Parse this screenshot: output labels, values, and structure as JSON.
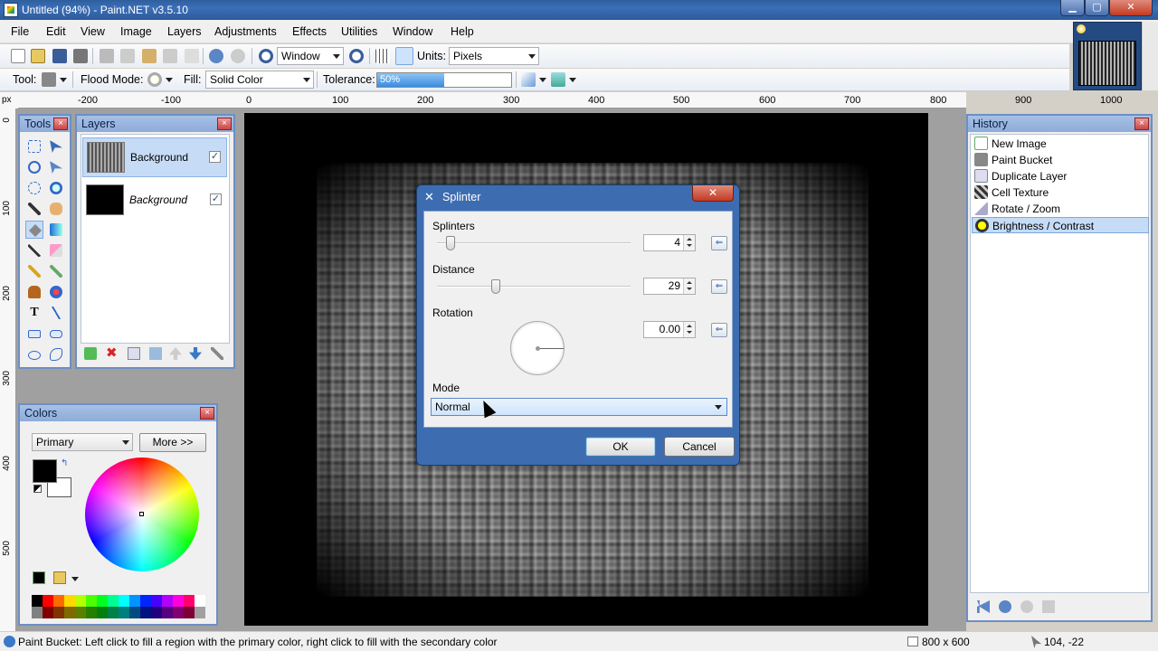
{
  "window": {
    "title": "Untitled (94%) - Paint.NET v3.5.10",
    "minimize_label": "▁",
    "maximize_label": "▢",
    "close_label": "✕"
  },
  "menu": [
    "File",
    "Edit",
    "View",
    "Image",
    "Layers",
    "Adjustments",
    "Effects",
    "Utilities",
    "Window",
    "Help"
  ],
  "toolbar": {
    "zoom_value": "Window",
    "units_label": "Units:",
    "units_value": "Pixels",
    "tool_label": "Tool:",
    "flood_mode_label": "Flood Mode:",
    "fill_label": "Fill:",
    "fill_value": "Solid Color",
    "tolerance_label": "Tolerance:",
    "tolerance_value": "50%",
    "tolerance_fraction": 0.5
  },
  "rulers": {
    "unit_label": "px",
    "h_ticks": [
      "-200",
      "-100",
      "0",
      "100",
      "200",
      "300",
      "400",
      "500",
      "600",
      "700",
      "800",
      "900",
      "1000"
    ],
    "v_ticks": [
      "0",
      "100",
      "200",
      "300",
      "400",
      "500"
    ]
  },
  "tools_panel": {
    "title": "Tools",
    "close": "×"
  },
  "layers_panel": {
    "title": "Layers",
    "close": "×",
    "layers": [
      {
        "name": "Background",
        "visible_mark": "✓"
      },
      {
        "name": "Background",
        "visible_mark": "✓"
      }
    ]
  },
  "colors_panel": {
    "title": "Colors",
    "close": "×",
    "selector_value": "Primary",
    "more_button": "More >>",
    "primary_color": "#000000",
    "secondary_color": "#ffffff",
    "palette": [
      "#000000",
      "#ff0000",
      "#ff6a00",
      "#ffd800",
      "#b6ff00",
      "#4cff00",
      "#00ff21",
      "#00ff90",
      "#00ffff",
      "#0094ff",
      "#0026ff",
      "#4800ff",
      "#b200ff",
      "#ff00dc",
      "#ff006e",
      "#ffffff",
      "#808080",
      "#7f0000",
      "#7f3300",
      "#7f6a00",
      "#5b7f00",
      "#267f00",
      "#007f0e",
      "#007f46",
      "#007f7f",
      "#004a7f",
      "#00137f",
      "#21007f",
      "#57007f",
      "#7f006e",
      "#7f0037",
      "#a0a0a0"
    ]
  },
  "history_panel": {
    "title": "History",
    "close": "×",
    "items": [
      "New Image",
      "Paint Bucket",
      "Duplicate Layer",
      "Cell Texture",
      "Rotate / Zoom",
      "Brightness / Contrast"
    ]
  },
  "dialog": {
    "title": "Splinter",
    "close": "✕",
    "splinters_label": "Splinters",
    "splinters_value": "4",
    "distance_label": "Distance",
    "distance_value": "29",
    "rotation_label": "Rotation",
    "rotation_value": "0.00",
    "mode_label": "Mode",
    "mode_value": "Normal",
    "ok": "OK",
    "cancel": "Cancel",
    "reset_glyph": "⇐"
  },
  "status": {
    "hint": "Paint Bucket: Left click to fill a region with the primary color, right click to fill with the secondary color",
    "image_size": "800 x 600",
    "cursor_pos": "104, -22"
  }
}
